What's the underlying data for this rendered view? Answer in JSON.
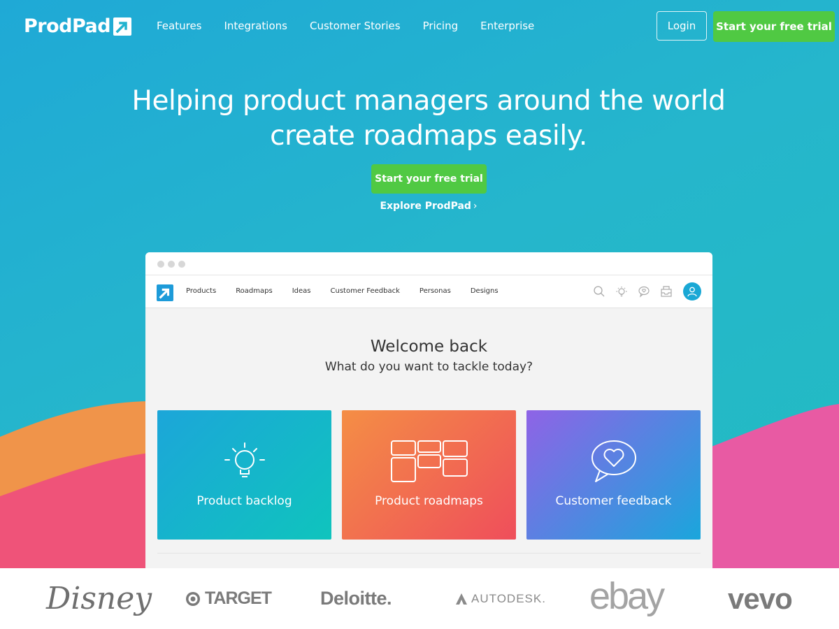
{
  "nav": {
    "logo_text": "ProdPad",
    "links": [
      "Features",
      "Integrations",
      "Customer Stories",
      "Pricing",
      "Enterprise"
    ],
    "login_label": "Login",
    "trial_label": "Start your free trial"
  },
  "hero": {
    "title_line1": "Helping product managers around the world",
    "title_line2": "create roadmaps easily.",
    "cta_label": "Start your free trial",
    "explore_label": "Explore ProdPad",
    "explore_icon": "chevron-right-icon"
  },
  "app": {
    "nav_links": [
      "Products",
      "Roadmaps",
      "Ideas",
      "Customer Feedback",
      "Personas",
      "Designs"
    ],
    "nav_icons": [
      "search-icon",
      "lightbulb-icon",
      "heart-bubble-icon",
      "inbox-icon",
      "user-avatar-icon"
    ],
    "welcome_title": "Welcome back",
    "welcome_subtitle": "What do you want to tackle today?",
    "cards": [
      {
        "label": "Product backlog",
        "icon": "lightbulb-icon"
      },
      {
        "label": "Product roadmaps",
        "icon": "roadmap-grid-icon"
      },
      {
        "label": "Customer feedback",
        "icon": "heart-bubble-icon"
      }
    ]
  },
  "brands": [
    "Disney",
    "TARGET",
    "Deloitte.",
    "AUTODESK.",
    "ebay",
    "vevo"
  ],
  "colors": {
    "background": "#22b3cf",
    "cta_green": "#50c943",
    "app_accent": "#1d9bd9",
    "wave_orange": "#f0944a",
    "wave_pink": "#ef5379",
    "wave_magenta": "#e85aa3"
  }
}
